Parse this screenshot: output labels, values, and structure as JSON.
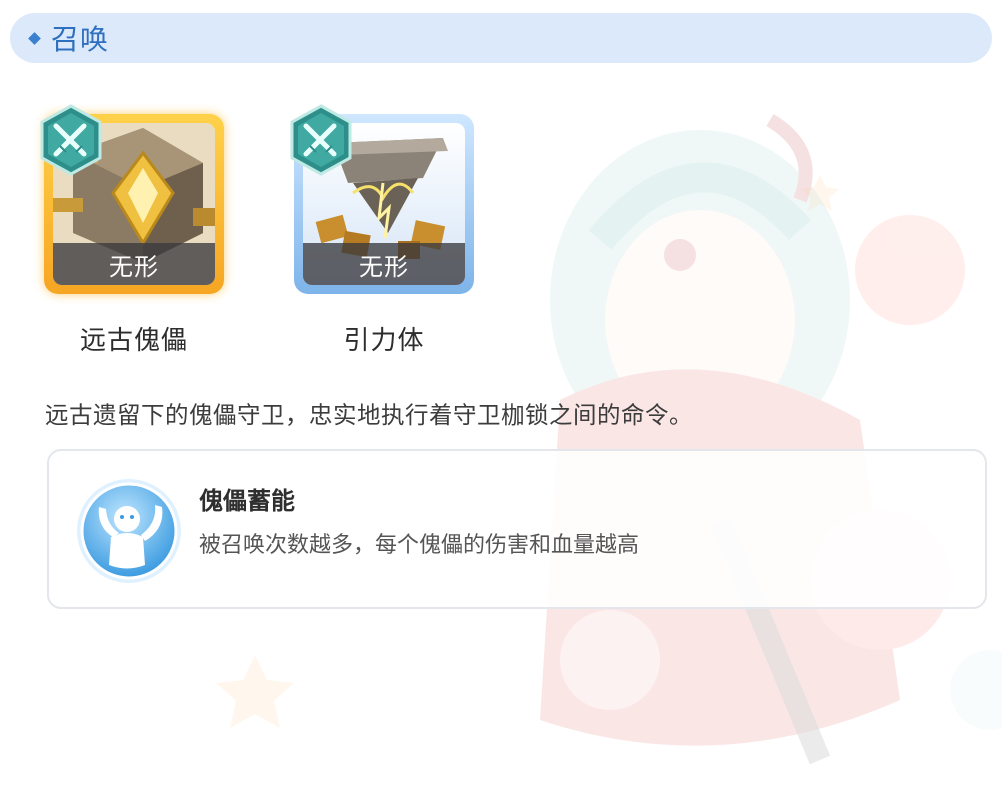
{
  "header": {
    "title": "召唤"
  },
  "units": [
    {
      "name": "远古傀儡",
      "type": "无形",
      "icon": "ancient-golem-icon",
      "frame_color": "#f6a623"
    },
    {
      "name": "引力体",
      "type": "无形",
      "icon": "gravity-body-icon",
      "frame_color": "#7eb4ea"
    }
  ],
  "description": "远古遗留下的傀儡守卫，忠实地执行着守卫枷锁之间的命令。",
  "skill": {
    "name": "傀儡蓄能",
    "description": "被召唤次数越多，每个傀儡的伤害和血量越高",
    "icon": "cheering-figure-icon"
  },
  "colors": {
    "accent": "#2f6fbf",
    "header_bg": "#dbe9fa",
    "badge": "#2e8f8a"
  }
}
